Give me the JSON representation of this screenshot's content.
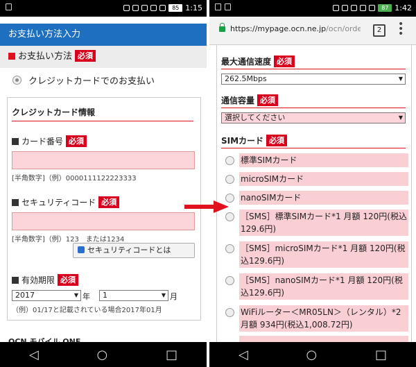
{
  "left": {
    "status": {
      "battery": "85",
      "time": "1:15"
    },
    "header_title": "お支払い方法入力",
    "payment_method_label": "お支払い方法",
    "required_badge": "必須",
    "credit_option": "クレジットカードでのお支払い",
    "card_info_title": "クレジットカード情報",
    "card_number_label": "カード番号",
    "card_number_hint": "[半角数字]（例）0000111122223333",
    "security_code_label": "セキュリティコード",
    "security_code_hint": "[半角数字]（例）123　または1234",
    "security_code_button": "セキュリティコードとは",
    "expiry_label": "有効期限",
    "expiry_year": "2017",
    "expiry_year_unit": "年",
    "expiry_month": "1",
    "expiry_month_unit": "月",
    "expiry_hint": "（例）01/17と記載されている場合2017年01月",
    "cut_text": "OCN モバイル ONE"
  },
  "right": {
    "status": {
      "battery": "87",
      "time": "1:42"
    },
    "url_host": "https://mypage.ocn.ne.jp",
    "url_path": "/ocn/order",
    "tab_count": "2",
    "max_speed_label": "最大通信速度",
    "max_speed_value": "262.5Mbps",
    "capacity_label": "通信容量",
    "capacity_placeholder": "選択してください",
    "sim_label": "SIMカード",
    "required_badge": "必須",
    "sim_options": [
      "標準SIMカード",
      "microSIMカード",
      "nanoSIMカード",
      "［SMS］標準SIMカード*1 月額 120円(税込129.6円)",
      "［SMS］microSIMカード*1 月額 120円(税込129.6円)",
      "［SMS］nanoSIMカード*1 月額 120円(税込129.6円)",
      "WiFiルーター＜MR05LN＞（レンタル）*2 月額 934円(税込1,008.72円)"
    ]
  },
  "colors": {
    "accent_red": "#d8001c",
    "header_blue": "#1e6fbf",
    "pink_field": "#fbd5d9"
  },
  "nav_icons": [
    "back-icon",
    "home-icon",
    "recents-icon"
  ]
}
